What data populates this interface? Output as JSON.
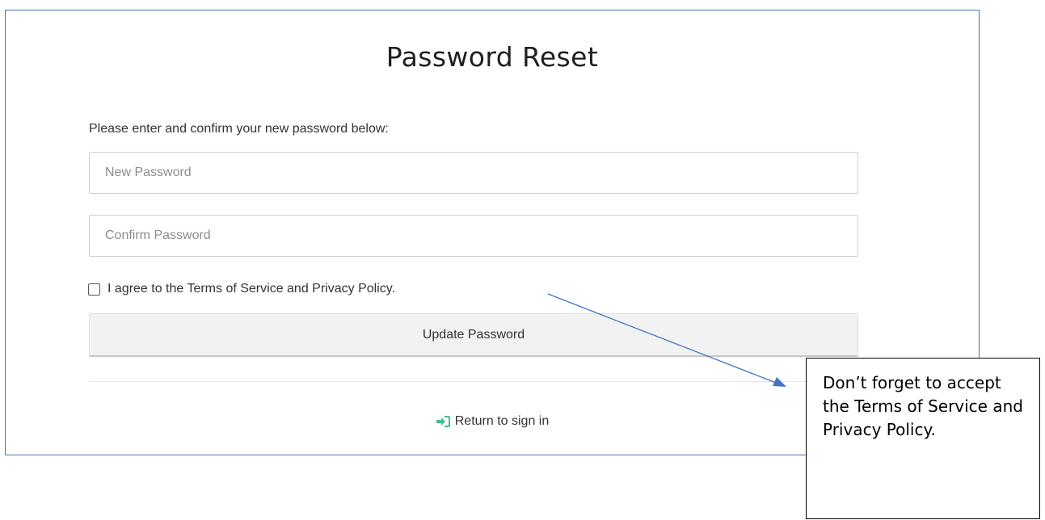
{
  "form": {
    "title": "Password Reset",
    "instructions": "Please enter and confirm your new password below:",
    "new_password": {
      "placeholder": "New Password",
      "value": ""
    },
    "confirm_password": {
      "placeholder": "Confirm Password",
      "value": ""
    },
    "terms": {
      "label": "I agree to the Terms of Service and Privacy Policy.",
      "checked": false
    },
    "submit_label": "Update Password",
    "return_link": {
      "label": "Return to sign in",
      "icon": "sign-in-icon"
    }
  },
  "annotation": {
    "callout_text": "Don’t forget to accept the Terms of Service and Privacy Policy."
  },
  "colors": {
    "panel_border": "#4472c4",
    "annotation_arrow": "#4472c4",
    "signin_icon": "#3fbf97"
  }
}
